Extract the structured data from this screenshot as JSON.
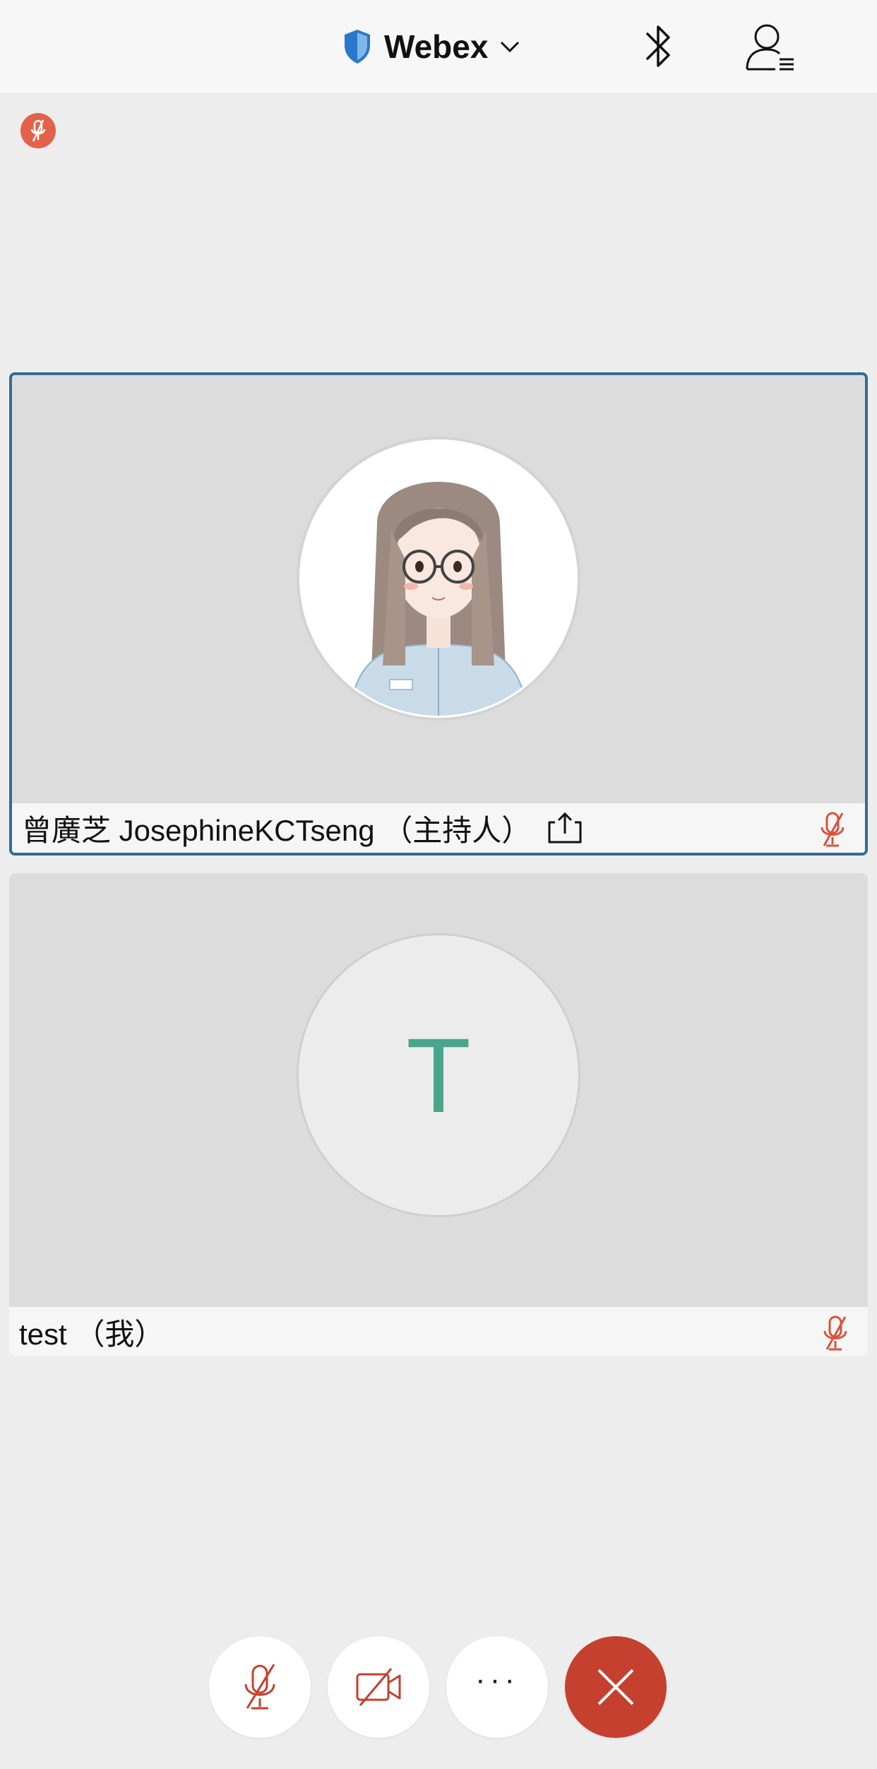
{
  "header": {
    "title": "Webex",
    "shield_icon": "shield-icon",
    "chevron_icon": "chevron-down-icon",
    "bluetooth_icon": "bluetooth-icon",
    "participants_icon": "participants-icon"
  },
  "self_status": {
    "icon": "muted-mic-icon",
    "color": "#e2634a"
  },
  "participants": [
    {
      "name": "曾廣芝 JosephineKCTseng （主持人）",
      "sharing_icon": "share-icon",
      "mic": "muted-mic-icon",
      "active": true,
      "avatar": "illustrated-portrait"
    },
    {
      "name": "test （我）",
      "initial": "T",
      "initial_color": "#4aa58d",
      "mic": "muted-mic-icon"
    }
  ],
  "controls": {
    "mute_icon": "muted-mic-icon",
    "video_icon": "video-off-icon",
    "more_label": "···",
    "leave_icon": "close-icon",
    "leave_color": "#c5402e"
  },
  "colors": {
    "accent": "#2f6e96",
    "mute_red": "#d9533c"
  }
}
